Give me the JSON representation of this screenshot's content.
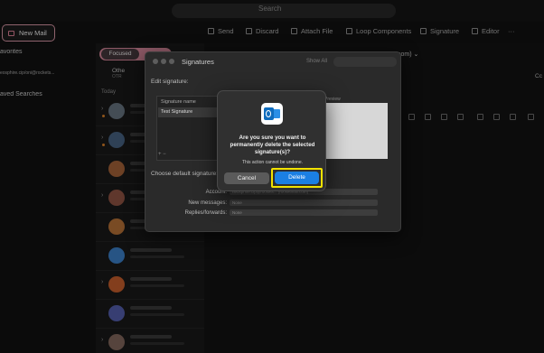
{
  "topbar": {
    "search_placeholder": "Search"
  },
  "toolbar": {
    "send": "Send",
    "discard": "Discard",
    "attach_file": "Attach File",
    "loop_components": "Loop Components",
    "signature": "Signature",
    "editor": "Editor",
    "more": "···"
  },
  "sidebar": {
    "new_mail": "New Mail",
    "favorites": "avorites",
    "account": "eosphire.cip/oni@rockets...",
    "saved_searches": "aved Searches"
  },
  "message_list": {
    "focused_tab": "Focused",
    "other_label": "Othe",
    "other_sub": "OTR",
    "today_label": "Today"
  },
  "compose": {
    "from_suffix": "com) ⌄",
    "cc_label": "Cc"
  },
  "signatures_window": {
    "title": "Signatures",
    "show_all": "Show All",
    "edit_signature": "Edit signature:",
    "signature_name_header": "Signature name",
    "signature_item": "Test Signature",
    "preview_label": "Preview",
    "add_remove": "+  −",
    "choose_default": "Choose default signature:",
    "account_label": "Account:",
    "account_value": "neosphire.cip@rockets... (rocketmail.com)",
    "new_messages_label": "New messages:",
    "new_messages_value": "None",
    "replies_label": "Replies/forwards:",
    "replies_value": "None"
  },
  "confirm_dialog": {
    "message": "Are you sure you want to permanently delete the selected signature(s)?",
    "subtext": "This action cannot be undone.",
    "cancel_label": "Cancel",
    "delete_label": "Delete",
    "highlight_color": "#f2e200",
    "primary_color": "#1b7fe3"
  },
  "avatar_colors": [
    "#6f7c8a",
    "#4c6a8c",
    "#b06a3d",
    "#9a5a48",
    "#c47a3a",
    "#3f88d6",
    "#d4642f",
    "#5a64b8",
    "#8b6f63"
  ]
}
